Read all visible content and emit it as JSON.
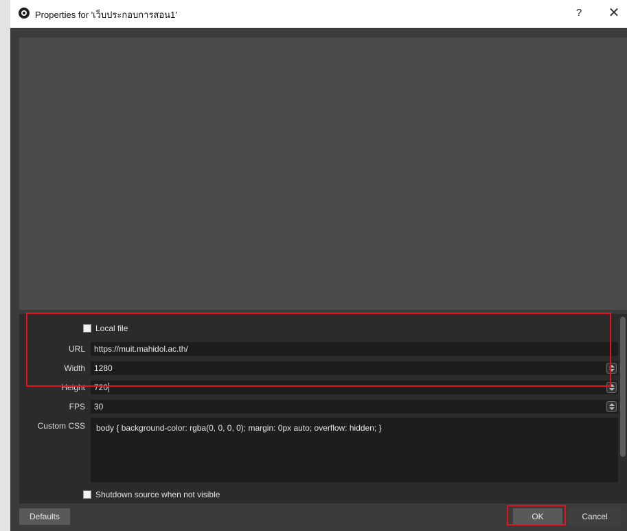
{
  "window": {
    "title": "Properties for 'เว็บประกอบการสอน1'",
    "help_label": "?",
    "close_label": "✕"
  },
  "properties": {
    "local_file_label": "Local file",
    "local_file_checked": false,
    "url_label": "URL",
    "url_value": "https://muit.mahidol.ac.th/",
    "width_label": "Width",
    "width_value": "1280",
    "height_label": "Height",
    "height_value": "720",
    "fps_label": "FPS",
    "fps_value": "30",
    "css_label": "Custom CSS",
    "css_value": "body { background-color: rgba(0, 0, 0, 0); margin: 0px auto; overflow: hidden; }",
    "shutdown_label": "Shutdown source when not visible",
    "shutdown_checked": false
  },
  "buttons": {
    "defaults_label": "Defaults",
    "ok_label": "OK",
    "cancel_label": "Cancel"
  },
  "colors": {
    "highlight": "#e0141e",
    "dialog_bg": "#3b3b3b",
    "preview_bg": "#4b4b4b",
    "field_bg": "#1d1d1d"
  },
  "icons": {
    "app": "obs-logo-icon",
    "close": "close-icon",
    "spin": "spinbox-arrows-icon"
  }
}
